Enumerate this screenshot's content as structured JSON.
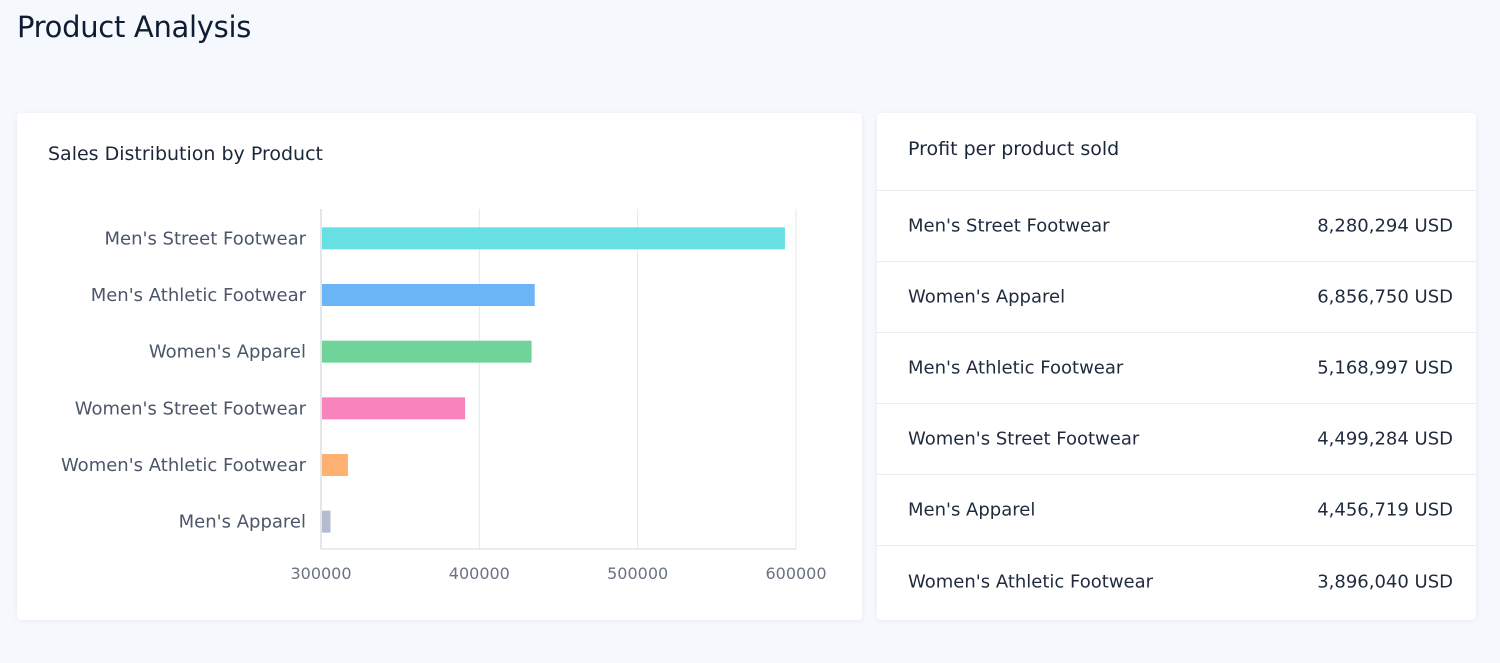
{
  "page": {
    "title": "Product Analysis"
  },
  "sales_card": {
    "title": "Sales Distribution by Product"
  },
  "profit_card": {
    "title": "Profit per product sold",
    "rows": [
      {
        "name": "Men's Street Footwear",
        "value": "8,280,294 USD"
      },
      {
        "name": "Women's Apparel",
        "value": "6,856,750 USD"
      },
      {
        "name": "Men's Athletic Footwear",
        "value": "5,168,997 USD"
      },
      {
        "name": "Women's Street Footwear",
        "value": "4,499,284 USD"
      },
      {
        "name": "Men's Apparel",
        "value": "4,456,719 USD"
      },
      {
        "name": "Women's Athletic Footwear",
        "value": "3,896,040 USD"
      }
    ]
  },
  "chart_data": {
    "type": "bar",
    "orientation": "horizontal",
    "title": "Sales Distribution by Product",
    "categories": [
      "Men's Street Footwear",
      "Men's Athletic Footwear",
      "Women's Apparel",
      "Women's Street Footwear",
      "Women's Athletic Footwear",
      "Men's Apparel"
    ],
    "values": [
      593000,
      435000,
      433000,
      391000,
      317000,
      306000
    ],
    "colors": [
      "#67e0e3",
      "#6bb5f7",
      "#70d49a",
      "#f883bd",
      "#fdb070",
      "#b4bcd0"
    ],
    "xlim": [
      300000,
      600000
    ],
    "xticks": [
      "300000",
      "400000",
      "500000",
      "600000"
    ],
    "xtick_values": [
      300000,
      400000,
      500000,
      600000
    ],
    "grid": true
  }
}
